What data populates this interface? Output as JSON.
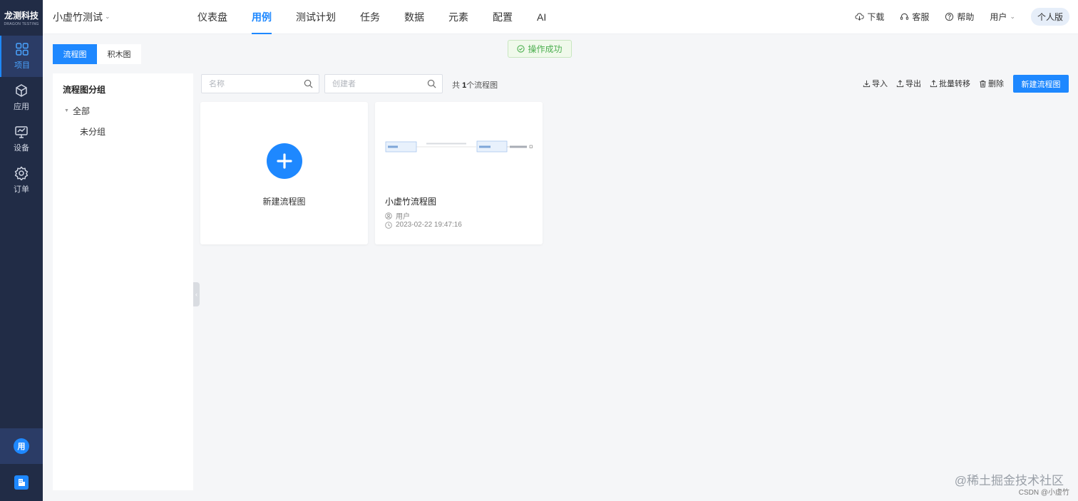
{
  "brand": {
    "name_cn": "龙测科技",
    "name_en": "DRAGON TESTING"
  },
  "rail": {
    "items": [
      {
        "label": "项目",
        "icon": "grid-icon",
        "active": true
      },
      {
        "label": "应用",
        "icon": "cube-icon",
        "active": false
      },
      {
        "label": "设备",
        "icon": "monitor-icon",
        "active": false
      },
      {
        "label": "订单",
        "icon": "gear-icon",
        "active": false
      }
    ],
    "user_avatar": "用",
    "org_icon": "building-icon"
  },
  "header": {
    "project": "小虚竹测试",
    "nav": [
      "仪表盘",
      "用例",
      "测试计划",
      "任务",
      "数据",
      "元素",
      "配置",
      "AI"
    ],
    "active_nav": "用例",
    "download": "下载",
    "service": "客服",
    "help": "帮助",
    "user": "用户",
    "edition": "个人版"
  },
  "toast": "操作成功",
  "tabs": [
    "流程图",
    "积木图"
  ],
  "groups": {
    "title": "流程图分组",
    "all": "全部",
    "ungrouped": "未分组"
  },
  "toolbar": {
    "name_placeholder": "名称",
    "creator_placeholder": "创建者",
    "count_prefix": "共",
    "count_value": "1",
    "count_suffix": "个流程图",
    "import": "导入",
    "export": "导出",
    "batch_move": "批量转移",
    "delete": "删除",
    "new_flow": "新建流程图"
  },
  "cards": {
    "new_label": "新建流程图",
    "flow": {
      "title": "小虚竹流程图",
      "creator": "用户",
      "created_at": "2023-02-22 19:47:16"
    }
  },
  "watermark": {
    "main": "@稀土掘金技术社区",
    "sub": "CSDN @小虚竹"
  },
  "colors": {
    "primary": "#1e88ff",
    "rail_bg": "#212c46",
    "success": "#4caf50"
  }
}
